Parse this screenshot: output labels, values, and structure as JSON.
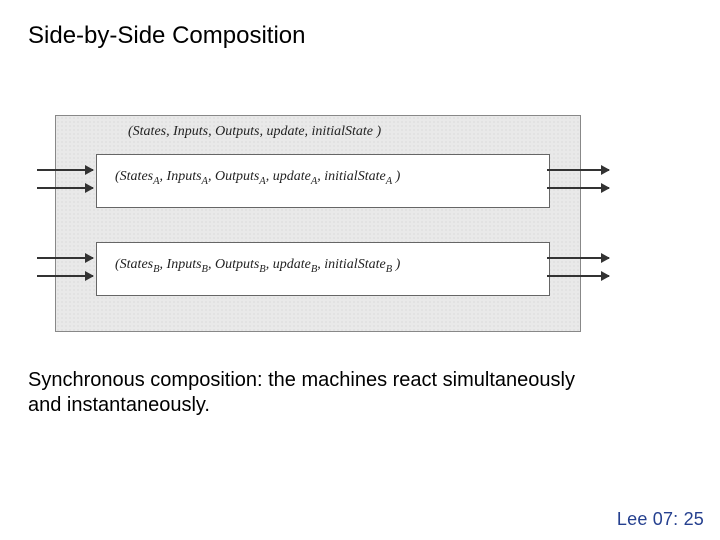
{
  "title": "Side-by-Side Composition",
  "outer_tuple": "(States, Inputs, Outputs, update, initialState )",
  "machine_a": {
    "prefix": "(States",
    "sub": "A",
    "mid1": ", Inputs",
    "mid2": ", Outputs",
    "mid3": ", update",
    "mid4": ", initialState",
    "end": " )"
  },
  "machine_b": {
    "prefix": "(States",
    "sub": "B",
    "mid1": ", Inputs",
    "mid2": ", Outputs",
    "mid3": ", update",
    "mid4": ", initialState",
    "end": " )"
  },
  "caption": "Synchronous composition: the machines react simultaneously and instantaneously.",
  "footer": "Lee 07: 25"
}
